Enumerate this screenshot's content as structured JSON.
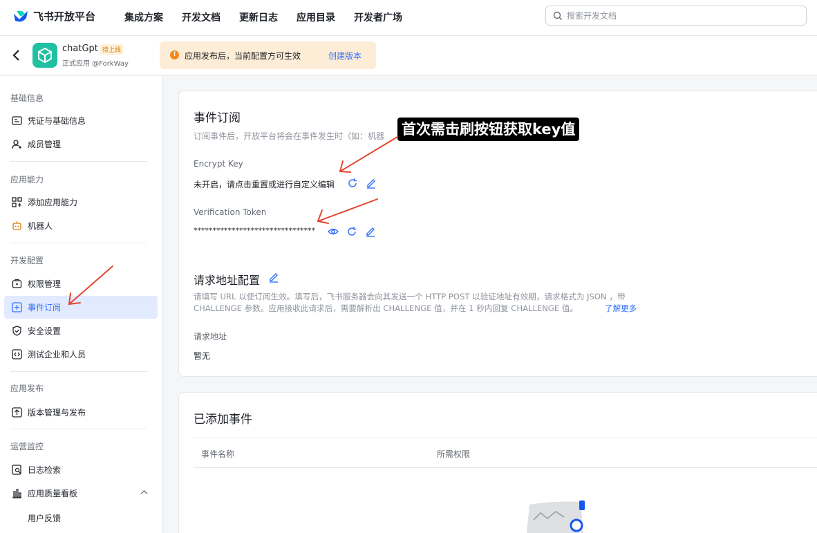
{
  "nav": {
    "brand": "飞书开放平台",
    "items": [
      "集成方案",
      "开发文档",
      "更新日志",
      "应用目录",
      "开发者广场"
    ],
    "search_placeholder": "搜索开发文档"
  },
  "app": {
    "name": "chatGpt",
    "badge": "待上线",
    "subtitle": "正式应用 @ForkWay",
    "notice": "应用发布后，当前配置方可生效",
    "notice_link": "创建版本",
    "icon_color": "#1fc1a2"
  },
  "sidebar": {
    "sections": [
      {
        "title": "基础信息",
        "items": [
          "凭证与基础信息",
          "成员管理"
        ]
      },
      {
        "title": "应用能力",
        "items": [
          "添加应用能力",
          "机器人"
        ]
      },
      {
        "title": "开发配置",
        "items": [
          "权限管理",
          "事件订阅",
          "安全设置",
          "测试企业和人员"
        ]
      },
      {
        "title": "应用发布",
        "items": [
          "版本管理与发布"
        ]
      },
      {
        "title": "运营监控",
        "items": [
          "日志检索",
          "应用质量看板"
        ]
      }
    ],
    "sub_items": [
      "用户反馈"
    ],
    "active": "事件订阅"
  },
  "events": {
    "title": "事件订阅",
    "desc": "订阅事件后，开放平台将会在事件发生时（如：机器",
    "encrypt_label": "Encrypt Key",
    "encrypt_value": "未开启，请点击重置或进行自定义编辑",
    "token_label": "Verification Token",
    "token_value": "********************************"
  },
  "request": {
    "title": "请求地址配置",
    "desc1": "请填写 URL 以使订阅生效。填写后，飞书服务器会向其发送一个 HTTP POST 以验证地址有效期，请求格式为 JSON ，带",
    "desc2": "CHALLENGE 参数。应用接收此请求后，需要解析出 CHALLENGE 值，并在 1 秒内回复 CHALLENGE 值。",
    "learn_more": "了解更多",
    "url_label": "请求地址",
    "url_value": "暂无"
  },
  "added": {
    "title": "已添加事件",
    "columns": [
      "事件名称",
      "所需权限"
    ]
  },
  "annotation": "首次需击刷按钮获取key值",
  "colors": {
    "accent": "#3370ff",
    "annotation_arrow": "#e8432e",
    "notice_bg": "#fdecd6"
  }
}
